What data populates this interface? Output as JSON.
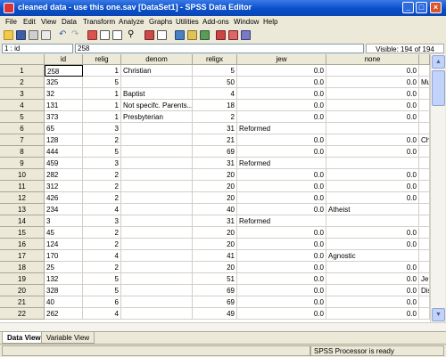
{
  "window": {
    "title": "cleaned data - use this one.sav [DataSet1] - SPSS Data Editor",
    "controls": [
      "_",
      "□",
      "×"
    ]
  },
  "menu": [
    "File",
    "Edit",
    "View",
    "Data",
    "Transform",
    "Analyze",
    "Graphs",
    "Utilities",
    "Add-ons",
    "Window",
    "Help"
  ],
  "toolbar_icons": [
    "open-icon",
    "save-icon",
    "print-icon",
    "recall-dialog-icon",
    "undo-icon",
    "redo-icon",
    "goto-case-icon",
    "variables-icon",
    "find-icon",
    "insert-cases-icon",
    "insert-variable-icon",
    "split-file-icon",
    "weight-cases-icon",
    "select-cases-icon",
    "value-labels-icon",
    "use-sets-icon",
    "show-all-icon"
  ],
  "cell_editor": {
    "reference": "1 : id",
    "value": "258",
    "visible": "Visible: 194 of 194 Variables"
  },
  "columns": [
    "id",
    "relig",
    "denom",
    "religx",
    "jew",
    "none"
  ],
  "rows": [
    {
      "n": "1",
      "id": "258",
      "relig": "1",
      "denom": "Christian",
      "religx": "5",
      "jew": "0.0",
      "none": "0.0",
      "extra": ""
    },
    {
      "n": "2",
      "id": "325",
      "relig": "5",
      "denom": "",
      "religx": "50",
      "jew": "0.0",
      "none": "0.0",
      "extra": "Mu"
    },
    {
      "n": "3",
      "id": "32",
      "relig": "1",
      "denom": "Baptist",
      "religx": "4",
      "jew": "0.0",
      "none": "0.0",
      "extra": ""
    },
    {
      "n": "4",
      "id": "131",
      "relig": "1",
      "denom": "Not specifc. Parents...",
      "religx": "18",
      "jew": "0.0",
      "none": "0.0",
      "extra": ""
    },
    {
      "n": "5",
      "id": "373",
      "relig": "1",
      "denom": "Presbyterian",
      "religx": "2",
      "jew": "0.0",
      "none": "0.0",
      "extra": ""
    },
    {
      "n": "6",
      "id": "65",
      "relig": "3",
      "denom": "",
      "religx": "31",
      "jew": "Reformed",
      "none": "",
      "extra": ""
    },
    {
      "n": "7",
      "id": "128",
      "relig": "2",
      "denom": "",
      "religx": "21",
      "jew": "0.0",
      "none": "0.0",
      "extra": "Chi"
    },
    {
      "n": "8",
      "id": "444",
      "relig": "5",
      "denom": "",
      "religx": "69",
      "jew": "0.0",
      "none": "0.0",
      "extra": ""
    },
    {
      "n": "9",
      "id": "459",
      "relig": "3",
      "denom": "",
      "religx": "31",
      "jew": "Reformed",
      "none": "",
      "extra": ""
    },
    {
      "n": "10",
      "id": "282",
      "relig": "2",
      "denom": "",
      "religx": "20",
      "jew": "0.0",
      "none": "0.0",
      "extra": ""
    },
    {
      "n": "11",
      "id": "312",
      "relig": "2",
      "denom": "",
      "religx": "20",
      "jew": "0.0",
      "none": "0.0",
      "extra": ""
    },
    {
      "n": "12",
      "id": "426",
      "relig": "2",
      "denom": "",
      "religx": "20",
      "jew": "0.0",
      "none": "0.0",
      "extra": ""
    },
    {
      "n": "13",
      "id": "234",
      "relig": "4",
      "denom": "",
      "religx": "40",
      "jew": "0.0",
      "none": "Atheist",
      "extra": ""
    },
    {
      "n": "14",
      "id": "3",
      "relig": "3",
      "denom": "",
      "religx": "31",
      "jew": "Reformed",
      "none": "",
      "extra": ""
    },
    {
      "n": "15",
      "id": "45",
      "relig": "2",
      "denom": "",
      "religx": "20",
      "jew": "0.0",
      "none": "0.0",
      "extra": ""
    },
    {
      "n": "16",
      "id": "124",
      "relig": "2",
      "denom": "",
      "religx": "20",
      "jew": "0.0",
      "none": "0.0",
      "extra": ""
    },
    {
      "n": "17",
      "id": "170",
      "relig": "4",
      "denom": "",
      "religx": "41",
      "jew": "0.0",
      "none": "Agnostic",
      "extra": ""
    },
    {
      "n": "18",
      "id": "25",
      "relig": "2",
      "denom": "",
      "religx": "20",
      "jew": "0.0",
      "none": "0.0",
      "extra": ""
    },
    {
      "n": "19",
      "id": "132",
      "relig": "5",
      "denom": "",
      "religx": "51",
      "jew": "0.0",
      "none": "0.0",
      "extra": "Jeh"
    },
    {
      "n": "20",
      "id": "328",
      "relig": "5",
      "denom": "",
      "religx": "69",
      "jew": "0.0",
      "none": "0.0",
      "extra": "Dis"
    },
    {
      "n": "21",
      "id": "40",
      "relig": "6",
      "denom": "",
      "religx": "69",
      "jew": "0.0",
      "none": "0.0",
      "extra": ""
    },
    {
      "n": "22",
      "id": "262",
      "relig": "4",
      "denom": "",
      "religx": "49",
      "jew": "0.0",
      "none": "0.0",
      "extra": ""
    }
  ],
  "tabs": [
    {
      "label": "Data View",
      "active": true
    },
    {
      "label": "Variable View",
      "active": false
    }
  ],
  "status": {
    "processor": "SPSS  Processor is ready"
  },
  "colors": {
    "title_bar": "#0a4fc9",
    "chrome": "#ece9d8",
    "grid_line": "#d4d0c8"
  }
}
